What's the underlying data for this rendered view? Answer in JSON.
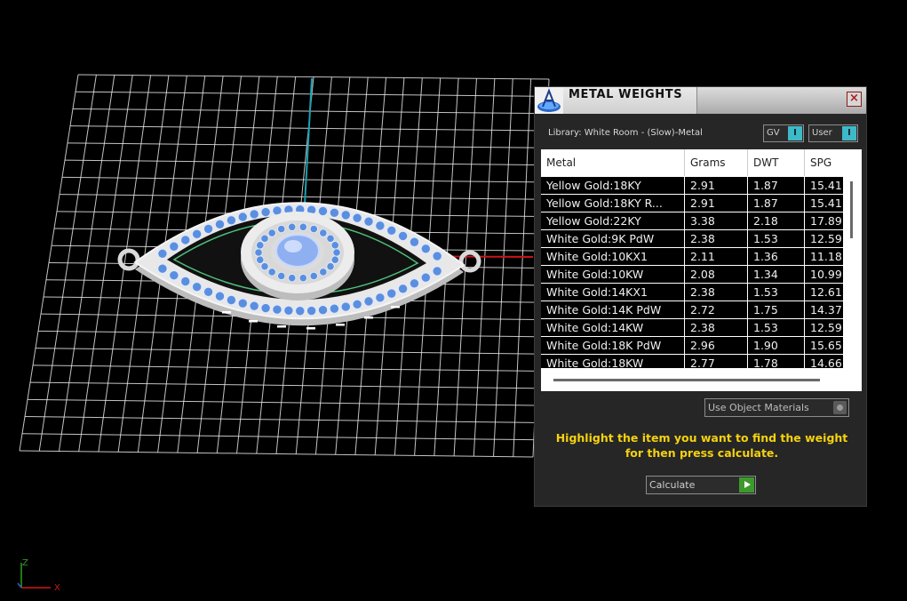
{
  "panel": {
    "title": "METAL WEIGHTS",
    "close_label": "×",
    "library_label": "Library: White Room - (Slow)-Metal",
    "gv_toggle_label": "GV",
    "user_toggle_label": "User",
    "table": {
      "columns": [
        "Metal",
        "Grams",
        "DWT",
        "SPG"
      ],
      "rows": [
        [
          "Yellow Gold:18KY",
          "2.91",
          "1.87",
          "15.41"
        ],
        [
          "Yellow Gold:18KY R...",
          "2.91",
          "1.87",
          "15.41"
        ],
        [
          "Yellow Gold:22KY",
          "3.38",
          "2.18",
          "17.89"
        ],
        [
          "White Gold:9K PdW",
          "2.38",
          "1.53",
          "12.59"
        ],
        [
          "White Gold:10KX1",
          "2.11",
          "1.36",
          "11.18"
        ],
        [
          "White Gold:10KW",
          "2.08",
          "1.34",
          "10.99"
        ],
        [
          "White Gold:14KX1",
          "2.38",
          "1.53",
          "12.61"
        ],
        [
          "White Gold:14K PdW",
          "2.72",
          "1.75",
          "14.37"
        ],
        [
          "White Gold:14KW",
          "2.38",
          "1.53",
          "12.59"
        ],
        [
          "White Gold:18K PdW",
          "2.96",
          "1.90",
          "15.65"
        ],
        [
          "White Gold:18KW",
          "2.77",
          "1.78",
          "14.66"
        ]
      ]
    },
    "use_object_materials_label": "Use Object Materials",
    "instruction": "Highlight the item you want to find the weight for then press calculate.",
    "calculate_label": "Calculate"
  },
  "axes": {
    "x_label": "X",
    "z_label": "Z"
  },
  "colors": {
    "grid": "#e6e6e6",
    "x_axis": "#d01818",
    "y_axis": "#1aa0b0",
    "instruction": "#f5d20f",
    "toggle_accent": "#3eb9c8",
    "go_button": "#3c9a2a",
    "stone": "#5a8fe0"
  }
}
